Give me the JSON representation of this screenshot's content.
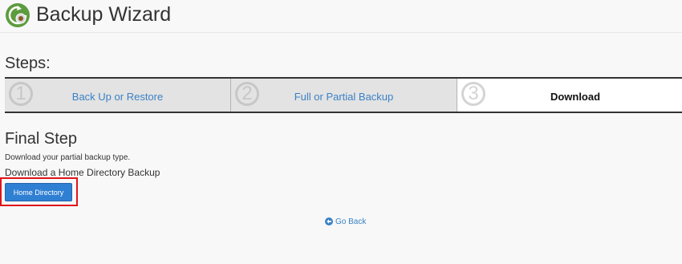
{
  "header": {
    "title": "Backup Wizard",
    "icon": "backup-wizard-icon"
  },
  "steps": {
    "heading": "Steps:",
    "items": [
      {
        "number": "1",
        "label": "Back Up or Restore",
        "state": "link"
      },
      {
        "number": "2",
        "label": "Full or Partial Backup",
        "state": "link"
      },
      {
        "number": "3",
        "label": "Download",
        "state": "current"
      }
    ]
  },
  "main": {
    "title": "Final Step",
    "description": "Download your partial backup type.",
    "download_heading": "Download a Home Directory Backup",
    "home_directory_button": "Home Directory",
    "go_back_label": "Go Back",
    "go_back_icon": "arrow-circle-left-icon"
  },
  "colors": {
    "link": "#3b81c5",
    "button": "#2f7fd3",
    "highlight": "#e0141a",
    "icon_green": "#5d9c3e"
  }
}
